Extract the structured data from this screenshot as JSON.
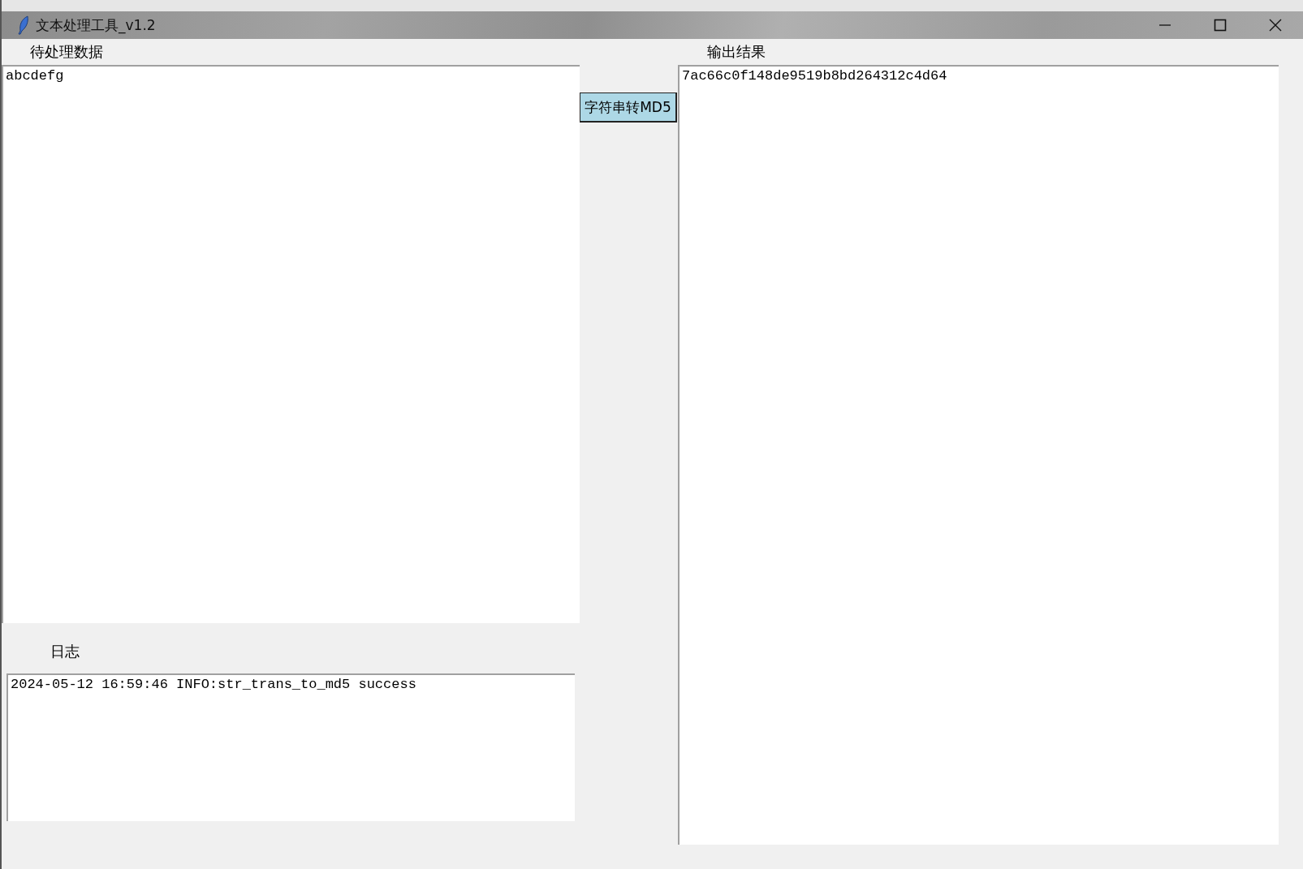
{
  "window": {
    "title": "文本处理工具_v1.2"
  },
  "input": {
    "label": "待处理数据",
    "value": "abcdefg"
  },
  "convert_button": {
    "label": "字符串转MD5"
  },
  "output": {
    "label": "输出结果",
    "value": "7ac66c0f148de9519b8bd264312c4d64"
  },
  "log": {
    "label": "日志",
    "lines": [
      "2024-05-12 16:59:46 INFO:str_trans_to_md5 success"
    ]
  }
}
